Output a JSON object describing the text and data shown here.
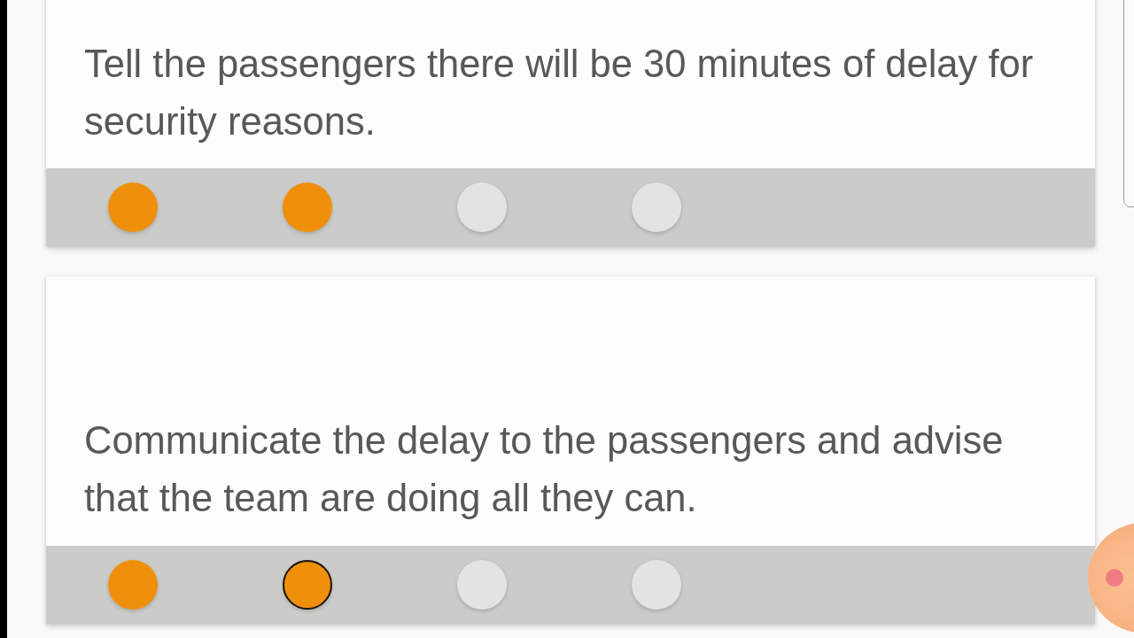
{
  "cards": [
    {
      "text": "Tell the passengers there will be 30 minutes of delay for security reasons.",
      "dots": [
        {
          "filled": true,
          "focused": false
        },
        {
          "filled": true,
          "focused": false
        },
        {
          "filled": false,
          "focused": false
        },
        {
          "filled": false,
          "focused": false
        }
      ]
    },
    {
      "text": "Communicate the delay to the passengers and advise that the team are doing all they can.",
      "dots": [
        {
          "filled": true,
          "focused": false
        },
        {
          "filled": true,
          "focused": true
        },
        {
          "filled": false,
          "focused": false
        },
        {
          "filled": false,
          "focused": false
        }
      ]
    }
  ]
}
